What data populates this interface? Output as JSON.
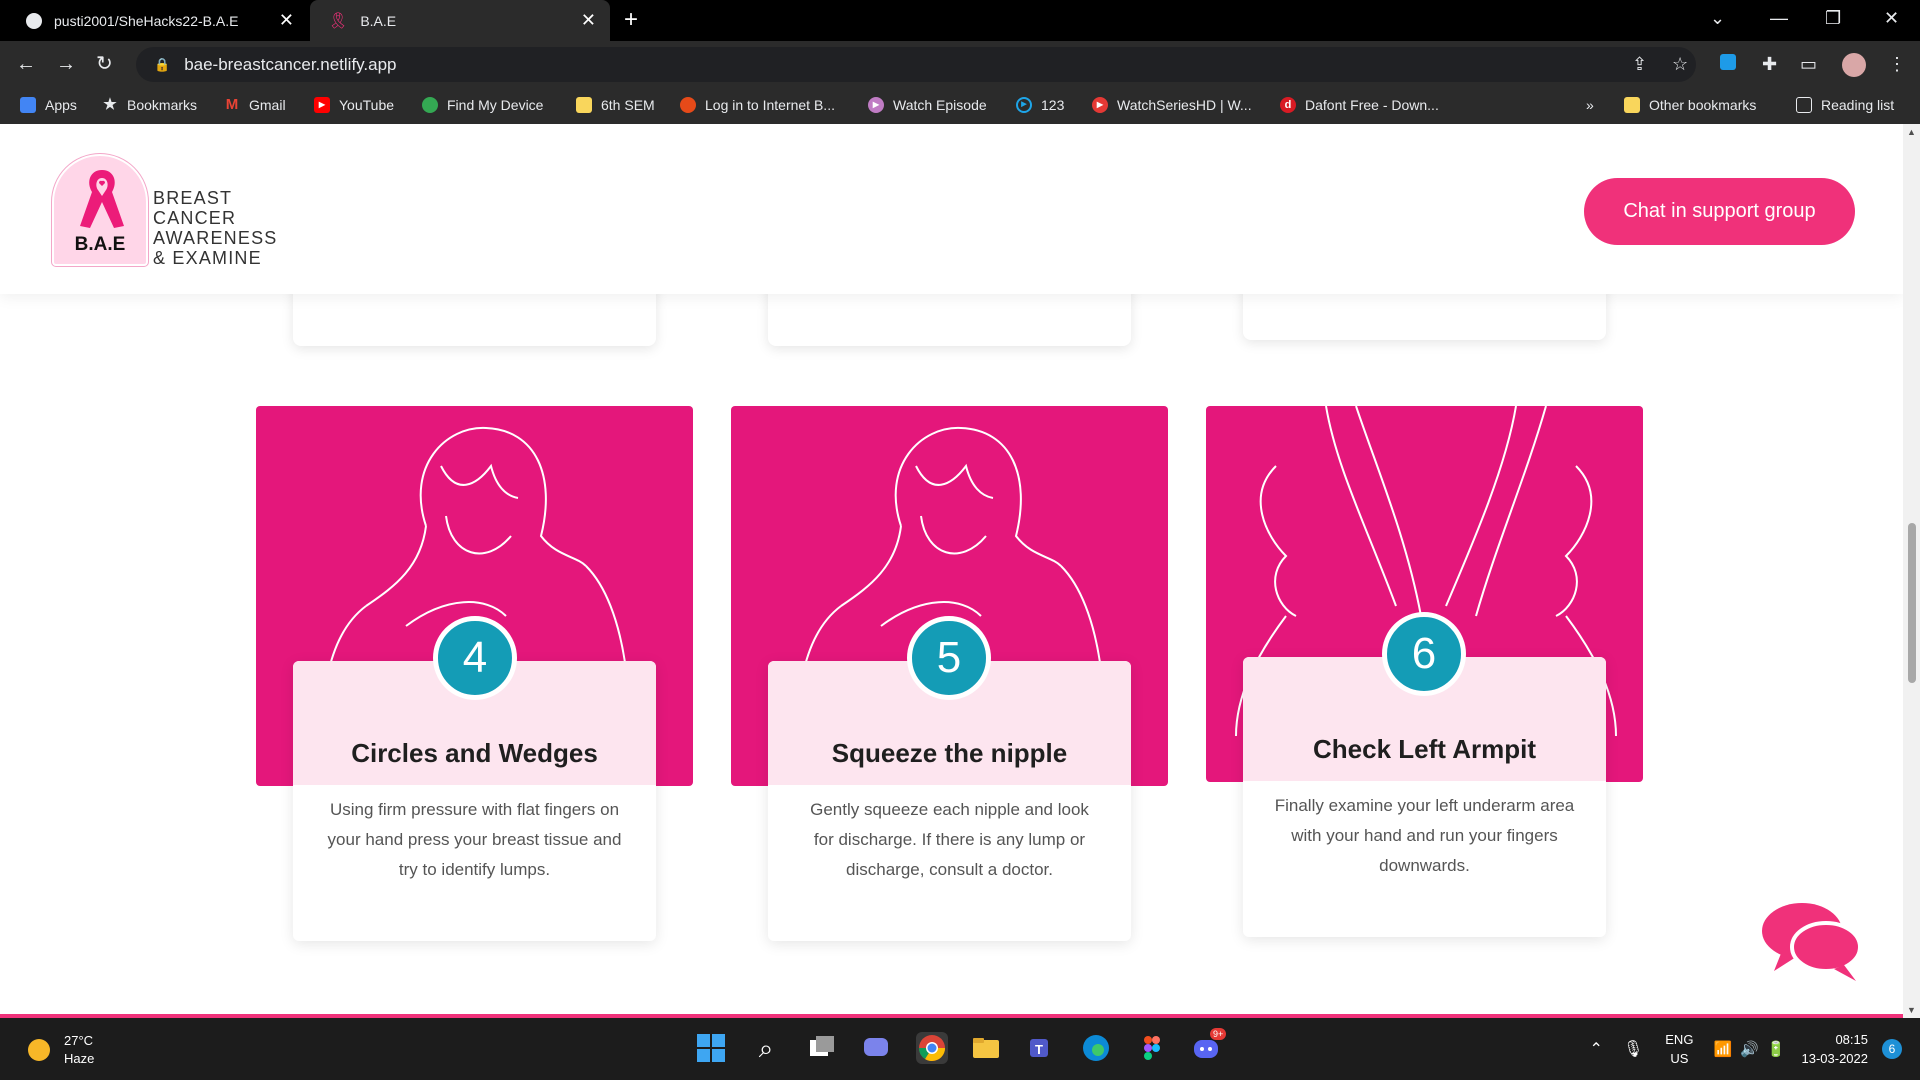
{
  "browser": {
    "tabs": [
      {
        "title": "pusti2001/SheHacks22-B.A.E",
        "icon": "github-icon"
      },
      {
        "title": "B.A.E",
        "icon": "ribbon-icon"
      }
    ],
    "url": "bae-breastcancer.netlify.app",
    "bookmarks": [
      {
        "label": "Apps",
        "color": "#4285f4"
      },
      {
        "label": "Bookmarks",
        "color": "#e8eaed"
      },
      {
        "label": "Gmail",
        "color": "#ea4335"
      },
      {
        "label": "YouTube",
        "color": "#ff0000"
      },
      {
        "label": "Find My Device",
        "color": "#34a853"
      },
      {
        "label": "6th SEM",
        "color": "#f9d65c"
      },
      {
        "label": "Log in to Internet B...",
        "color": "#e64a19"
      },
      {
        "label": "Watch Episode",
        "color": "#c07cc4"
      },
      {
        "label": "123",
        "color": "#1ea5e8"
      },
      {
        "label": "WatchSeriesHD | W...",
        "color": "#e53935"
      },
      {
        "label": "Dafont Free - Down...",
        "color": "#d81b24"
      }
    ],
    "more_bookmarks": "»",
    "other_bookmarks": "Other bookmarks",
    "reading_list": "Reading list"
  },
  "site": {
    "logo_text_lines": [
      "BREAST",
      "CANCER",
      "AWARENESS",
      "& EXAMINE"
    ],
    "logo_badge": "B.A.E",
    "chat_button": "Chat in support group",
    "accent": "#f0317a",
    "panel_color": "#e4177b",
    "number_color": "#149cb6",
    "steps": [
      {
        "number": "4",
        "title": "Circles and Wedges",
        "description": "Using firm pressure with flat fingers on your hand press your breast tissue and try to identify lumps."
      },
      {
        "number": "5",
        "title": "Squeeze the nipple",
        "description": "Gently squeeze each nipple and look for discharge. If there is any lump or discharge, consult a doctor."
      },
      {
        "number": "6",
        "title": "Check Left Armpit",
        "description": "Finally examine your left underarm area with your hand and run your fingers downwards."
      }
    ]
  },
  "taskbar": {
    "temperature": "27°C",
    "weather": "Haze",
    "language": "ENG",
    "region": "US",
    "time": "08:15",
    "date": "13-03-2022",
    "notifications": "6",
    "discord_badge": "9+"
  }
}
